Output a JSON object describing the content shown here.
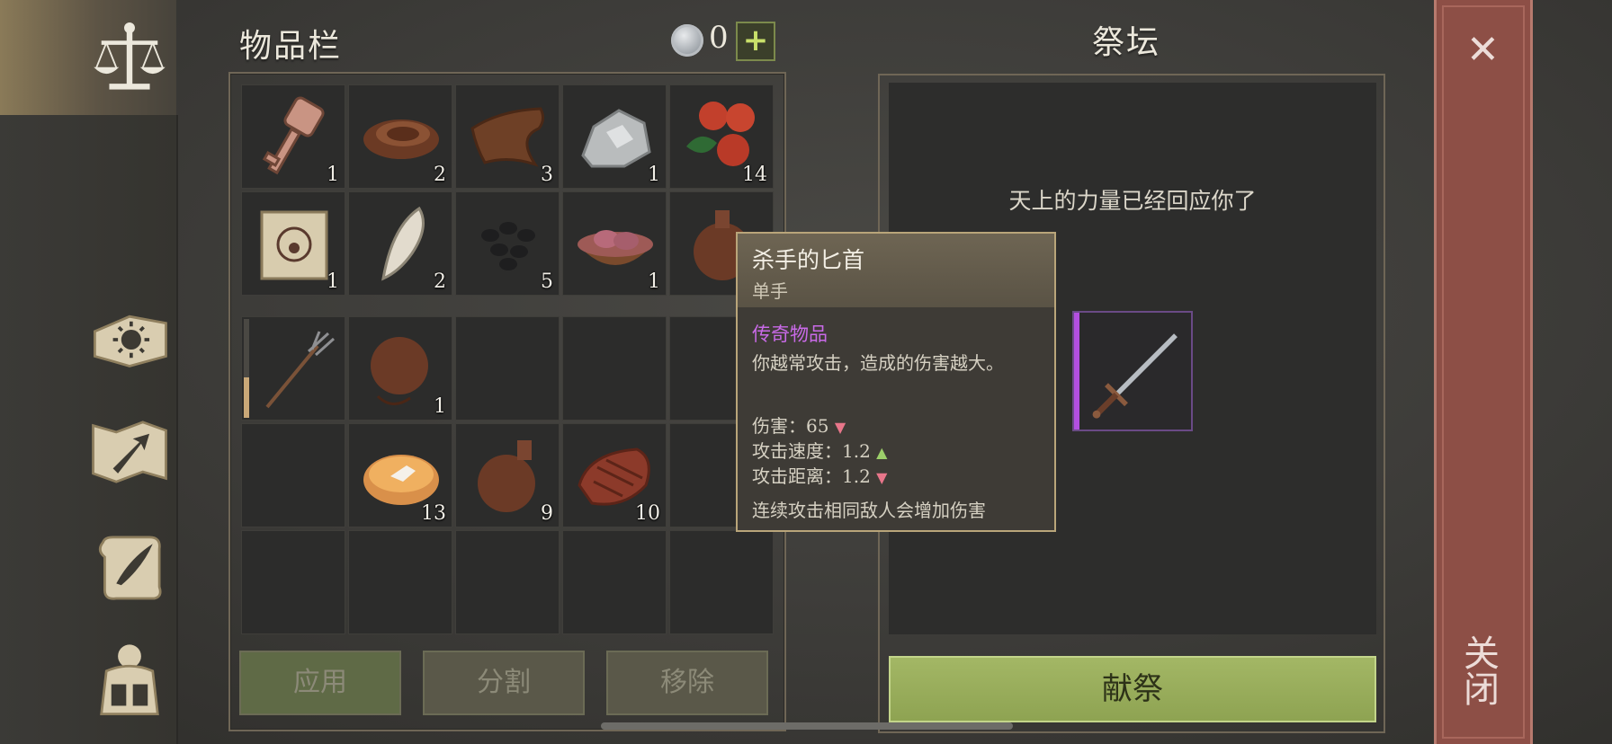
{
  "inventory": {
    "title": "物品栏",
    "currency_count": "0",
    "add_label": "+",
    "slots": [
      {
        "item": "key",
        "qty": "1"
      },
      {
        "item": "leather-strip",
        "qty": "2"
      },
      {
        "item": "leather-hide",
        "qty": "3"
      },
      {
        "item": "stone",
        "qty": "1"
      },
      {
        "item": "berries",
        "qty": "14"
      },
      {
        "item": "scroll",
        "qty": "1"
      },
      {
        "item": "fang",
        "qty": "2"
      },
      {
        "item": "coal",
        "qty": "5"
      },
      {
        "item": "raw-meat-bowl",
        "qty": "1"
      },
      {
        "item": "flask",
        "qty": ""
      },
      {
        "item": "pitchfork",
        "qty": ""
      },
      {
        "item": "sack",
        "qty": "1"
      },
      {
        "item": "",
        "qty": ""
      },
      {
        "item": "",
        "qty": ""
      },
      {
        "item": "",
        "qty": ""
      },
      {
        "item": "",
        "qty": ""
      },
      {
        "item": "pie",
        "qty": "13"
      },
      {
        "item": "flask",
        "qty": "9"
      },
      {
        "item": "steak",
        "qty": "10"
      },
      {
        "item": "",
        "qty": ""
      }
    ],
    "buttons": {
      "apply": "应用",
      "split": "分割",
      "remove": "移除"
    }
  },
  "tooltip": {
    "name": "杀手的匕首",
    "type": "单手",
    "rarity": "传奇物品",
    "description": "你越常攻击，造成的伤害越大。",
    "stats": [
      {
        "label": "伤害：",
        "value": "65",
        "trend": "down"
      },
      {
        "label": "攻击速度：",
        "value": "1.2",
        "trend": "up"
      },
      {
        "label": "攻击距离：",
        "value": "1.2",
        "trend": "down"
      }
    ],
    "footer": "连续攻击相同敌人会增加伤害"
  },
  "altar": {
    "title": "祭坛",
    "message": "天上的力量已经回应你了",
    "offered_item": "dagger",
    "sacrifice_label": "献祭"
  },
  "close_label": "关闭",
  "sidebar": {
    "icons": [
      "scales-icon",
      "sun-book-icon",
      "map-arrow-icon",
      "quill-scroll-icon",
      "backpack-icon"
    ]
  },
  "colors": {
    "legendary": "#c96ae8",
    "accent_green": "#9bb05e",
    "close_panel": "#8d4f46"
  }
}
